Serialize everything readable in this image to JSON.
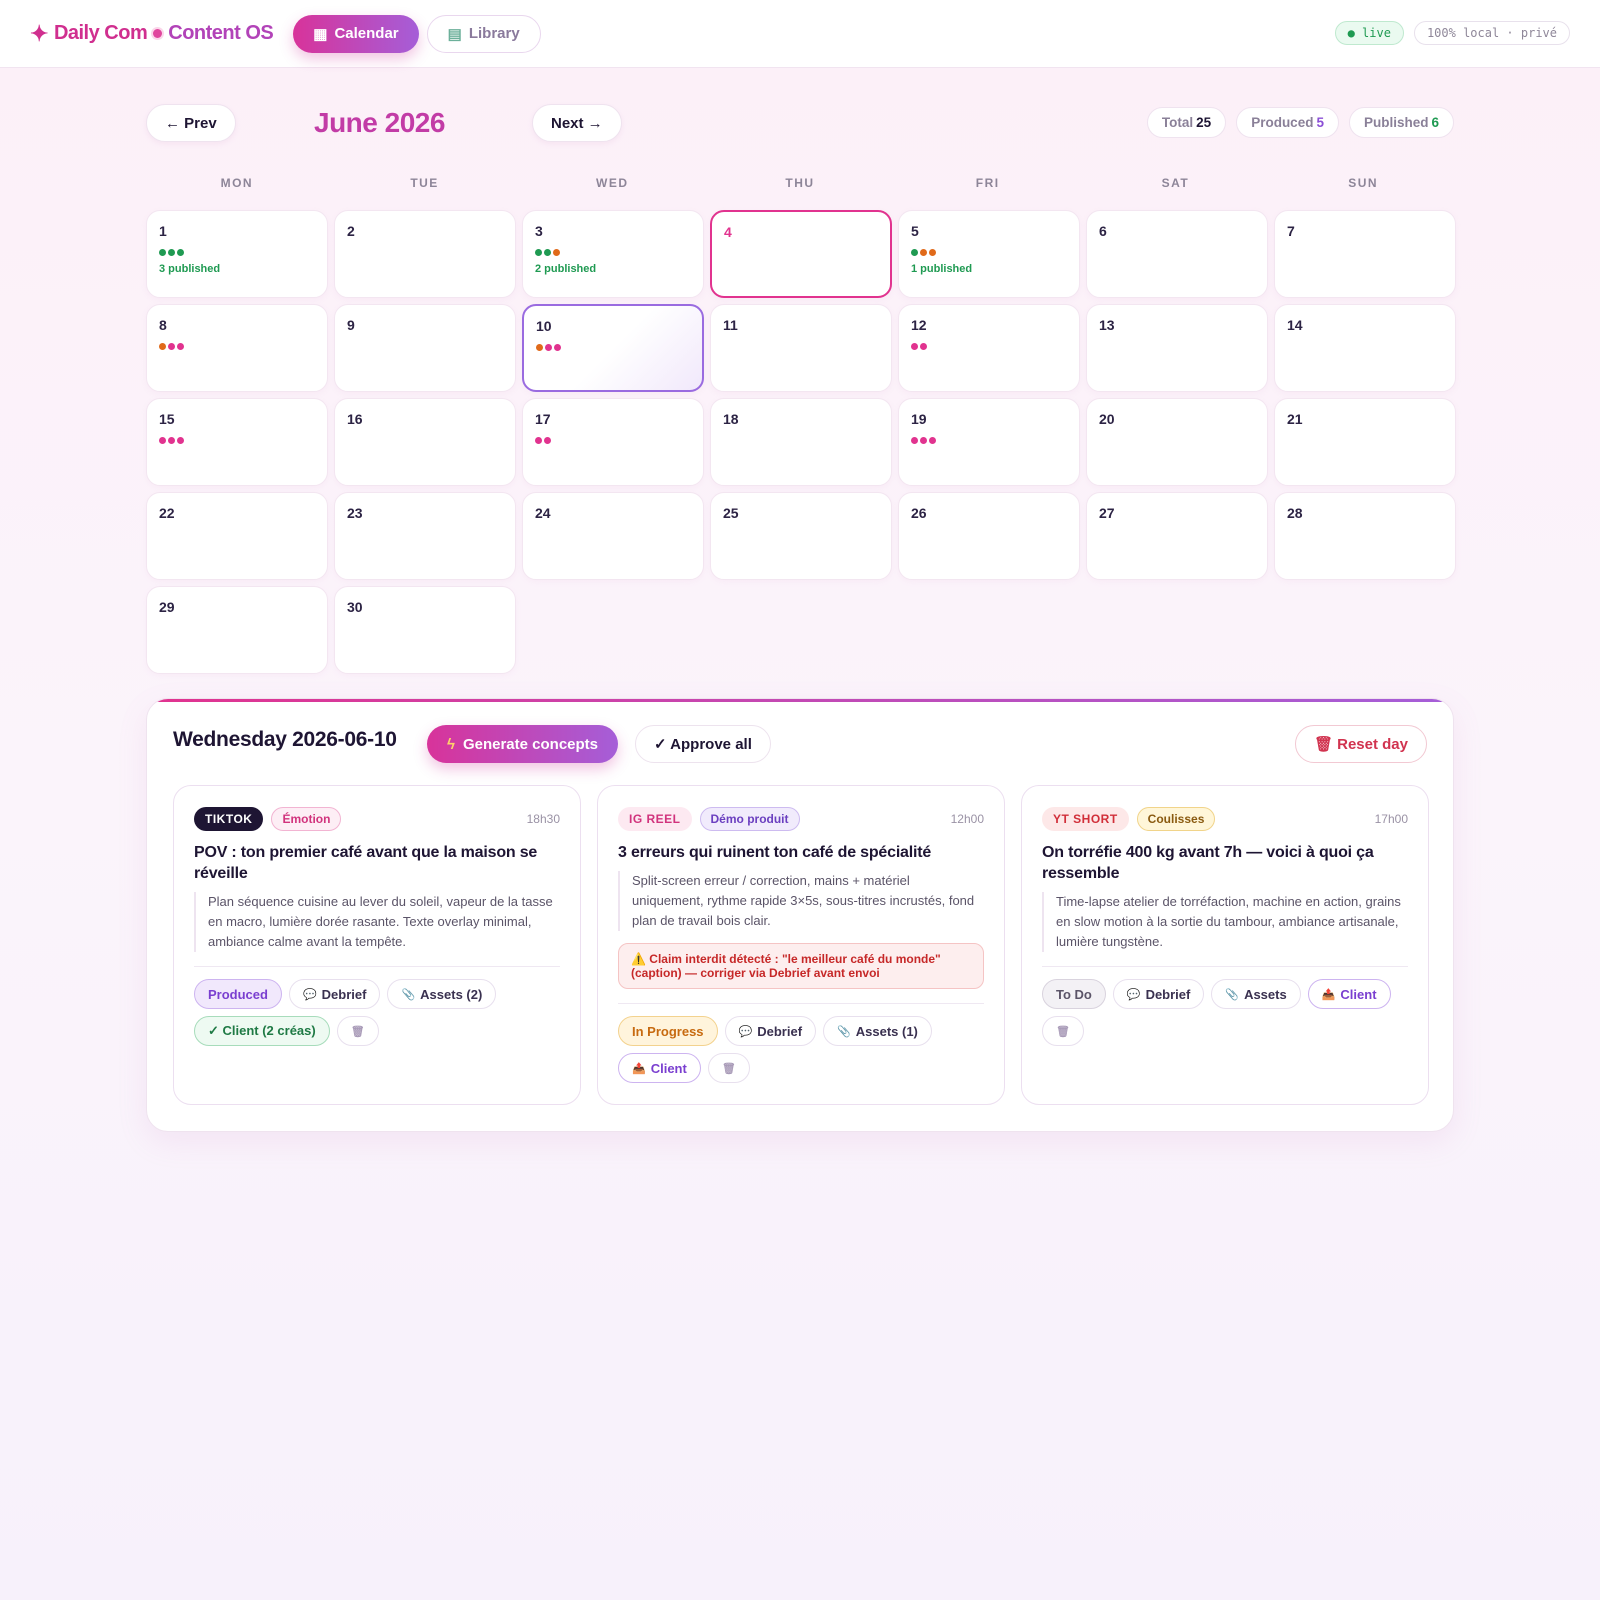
{
  "app": {
    "brand_part1": "Daily Com",
    "brand_part2": "Content OS",
    "tabs": [
      {
        "label": "Calendar",
        "icon": "calendar-icon",
        "active": true
      },
      {
        "label": "Library",
        "icon": "books-icon",
        "active": false
      }
    ],
    "status_live": "● live",
    "status_local": "100% local · privé"
  },
  "calendar": {
    "prev_label": "← Prev",
    "next_label": "Next →",
    "month_title": "June 2026",
    "stats": [
      {
        "label": "Total",
        "value": "25",
        "color": "#1e1533"
      },
      {
        "label": "Produced",
        "value": "5",
        "color": "#8b4fd6"
      },
      {
        "label": "Published",
        "value": "6",
        "color": "#1f9a52"
      }
    ],
    "weekdays": [
      "MON",
      "TUE",
      "WED",
      "THU",
      "FRI",
      "SAT",
      "SUN"
    ],
    "days": [
      {
        "n": "1",
        "dots": [
          "#1f9a52",
          "#1f9a52",
          "#1f9a52"
        ],
        "published": "3 published"
      },
      {
        "n": "2",
        "dots": [],
        "published": ""
      },
      {
        "n": "3",
        "dots": [
          "#1f9a52",
          "#1f9a52",
          "#e06a1a"
        ],
        "published": "2 published"
      },
      {
        "n": "4",
        "dots": [],
        "published": "",
        "today": true
      },
      {
        "n": "5",
        "dots": [
          "#1f9a52",
          "#e06a1a",
          "#e06a1a"
        ],
        "published": "1 published"
      },
      {
        "n": "6",
        "dots": [],
        "published": ""
      },
      {
        "n": "7",
        "dots": [],
        "published": ""
      },
      {
        "n": "8",
        "dots": [
          "#e06a1a",
          "#e1338f",
          "#e1338f"
        ],
        "published": ""
      },
      {
        "n": "9",
        "dots": [],
        "published": ""
      },
      {
        "n": "10",
        "dots": [
          "#e06a1a",
          "#e1338f",
          "#e1338f"
        ],
        "published": "",
        "selected": true
      },
      {
        "n": "11",
        "dots": [],
        "published": ""
      },
      {
        "n": "12",
        "dots": [
          "#e1338f",
          "#e1338f"
        ],
        "published": ""
      },
      {
        "n": "13",
        "dots": [],
        "published": ""
      },
      {
        "n": "14",
        "dots": [],
        "published": ""
      },
      {
        "n": "15",
        "dots": [
          "#e1338f",
          "#e1338f",
          "#e1338f"
        ],
        "published": ""
      },
      {
        "n": "16",
        "dots": [],
        "published": ""
      },
      {
        "n": "17",
        "dots": [
          "#e1338f",
          "#e1338f"
        ],
        "published": ""
      },
      {
        "n": "18",
        "dots": [],
        "published": ""
      },
      {
        "n": "19",
        "dots": [
          "#e1338f",
          "#e1338f",
          "#e1338f"
        ],
        "published": ""
      },
      {
        "n": "20",
        "dots": [],
        "published": ""
      },
      {
        "n": "21",
        "dots": [],
        "published": ""
      },
      {
        "n": "22",
        "dots": [],
        "published": ""
      },
      {
        "n": "23",
        "dots": [],
        "published": ""
      },
      {
        "n": "24",
        "dots": [],
        "published": ""
      },
      {
        "n": "25",
        "dots": [],
        "published": ""
      },
      {
        "n": "26",
        "dots": [],
        "published": ""
      },
      {
        "n": "27",
        "dots": [],
        "published": ""
      },
      {
        "n": "28",
        "dots": [],
        "published": ""
      },
      {
        "n": "29",
        "dots": [],
        "published": ""
      },
      {
        "n": "30",
        "dots": [],
        "published": ""
      }
    ]
  },
  "day_panel": {
    "title": "Wednesday 2026-06-10",
    "generate_label": "Generate concepts",
    "approve_label": "✓ Approve all",
    "reset_label": "Reset day",
    "cards": [
      {
        "platform": "TIKTOK",
        "platform_bg": "#1e1533",
        "platform_fg": "#ffffff",
        "tag": "Émotion",
        "tag_fg": "#d1337d",
        "tag_bg": "#fdeef5",
        "tag_border": "#f2b4d2",
        "time": "18h30",
        "title": "POV : ton premier café avant que la maison se réveille",
        "desc": "Plan séquence cuisine au lever du soleil, vapeur de la tasse en macro, lumière dorée rasante. Texte overlay minimal, ambiance calme avant la tempête.",
        "warning": "",
        "actions": [
          {
            "label": "Produced",
            "icon": "",
            "fg": "#7a3fd0",
            "bg": "#f1e8fc",
            "border": "#cdb4f0"
          },
          {
            "label": "Debrief",
            "icon": "💬",
            "fg": "#3a3150",
            "bg": "#ffffff",
            "border": "#e8e0ee"
          },
          {
            "label": "Assets (2)",
            "icon": "📎",
            "fg": "#3a3150",
            "bg": "#ffffff",
            "border": "#e8e0ee"
          },
          {
            "label": "✓ Client (2 créas)",
            "icon": "",
            "fg": "#1f7a45",
            "bg": "#eefaf2",
            "border": "#a7dcbb"
          },
          {
            "label": "",
            "icon": "🗑",
            "fg": "#3a3150",
            "bg": "#ffffff",
            "border": "#e8e0ee"
          }
        ]
      },
      {
        "platform": "IG REEL",
        "platform_bg": "#fde9f1",
        "platform_fg": "#d1337d",
        "tag": "Démo produit",
        "tag_fg": "#6b3fc0",
        "tag_bg": "#f1ebfc",
        "tag_border": "#cdbbf0",
        "time": "12h00",
        "title": "3 erreurs qui ruinent ton café de spécialité",
        "desc": "Split-screen erreur / correction, mains + matériel uniquement, rythme rapide 3×5s, sous-titres incrustés, fond plan de travail bois clair.",
        "warning": "⚠️ Claim interdit détecté : \"le meilleur café du monde\" (caption) — corriger via Debrief avant envoi",
        "actions": [
          {
            "label": "In Progress",
            "icon": "",
            "fg": "#c76a10",
            "bg": "#fff4dc",
            "border": "#f3d28e"
          },
          {
            "label": "Debrief",
            "icon": "💬",
            "fg": "#3a3150",
            "bg": "#ffffff",
            "border": "#e8e0ee"
          },
          {
            "label": "Assets (1)",
            "icon": "📎",
            "fg": "#3a3150",
            "bg": "#ffffff",
            "border": "#e8e0ee"
          },
          {
            "label": "Client",
            "icon": "📤",
            "fg": "#7a3fd0",
            "bg": "#ffffff",
            "border": "#cdb4f0"
          },
          {
            "label": "",
            "icon": "🗑",
            "fg": "#3a3150",
            "bg": "#ffffff",
            "border": "#e8e0ee"
          }
        ]
      },
      {
        "platform": "YT SHORT",
        "platform_bg": "#fde8e8",
        "platform_fg": "#d12f3a",
        "tag": "Coulisses",
        "tag_fg": "#8a5a10",
        "tag_bg": "#fff6d9",
        "tag_border": "#f1d48a",
        "time": "17h00",
        "title": "On torréfie 400 kg avant 7h — voici à quoi ça ressemble",
        "desc": "Time-lapse atelier de torréfaction, machine en action, grains en slow motion à la sortie du tambour, ambiance artisanale, lumière tungstène.",
        "warning": "",
        "actions": [
          {
            "label": "To Do",
            "icon": "",
            "fg": "#5b5468",
            "bg": "#f3f1f5",
            "border": "#d9d3de"
          },
          {
            "label": "Debrief",
            "icon": "💬",
            "fg": "#3a3150",
            "bg": "#ffffff",
            "border": "#e8e0ee"
          },
          {
            "label": "Assets",
            "icon": "📎",
            "fg": "#3a3150",
            "bg": "#ffffff",
            "border": "#e8e0ee"
          },
          {
            "label": "Client",
            "icon": "📤",
            "fg": "#7a3fd0",
            "bg": "#ffffff",
            "border": "#cdb4f0"
          },
          {
            "label": "",
            "icon": "🗑",
            "fg": "#3a3150",
            "bg": "#ffffff",
            "border": "#e8e0ee"
          }
        ]
      }
    ]
  }
}
